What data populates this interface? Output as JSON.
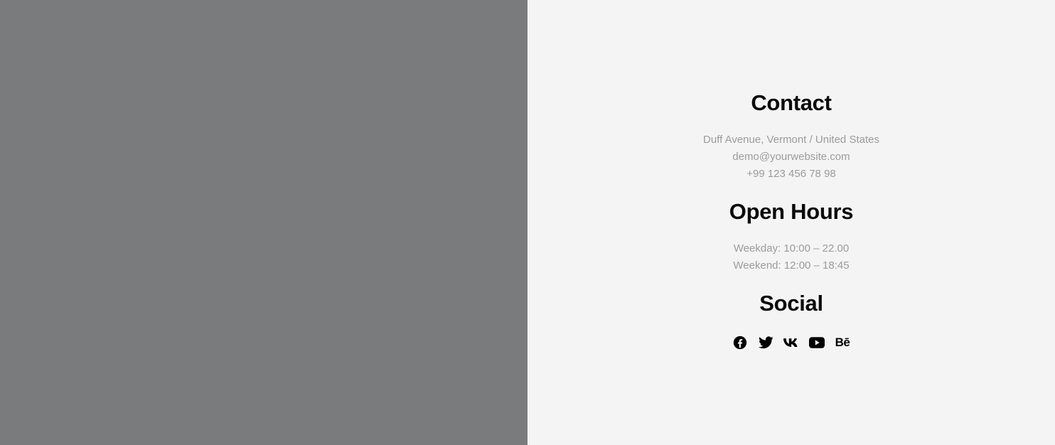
{
  "colors": {
    "image_panel_bg": "#7a7b7d",
    "info_panel_bg": "#f4f4f4",
    "heading": "#0a0a0a",
    "body_text": "#9b9b9b"
  },
  "contact": {
    "title": "Contact",
    "address": "Duff Avenue, Vermont / United States",
    "email": "demo@yourwebsite.com",
    "phone": "+99 123 456 78 98"
  },
  "hours": {
    "title": "Open Hours",
    "weekday": "Weekday: 10:00 – 22.00",
    "weekend": "Weekend: 12:00 – 18:45"
  },
  "social": {
    "title": "Social",
    "links": [
      {
        "icon": "facebook-icon"
      },
      {
        "icon": "twitter-icon"
      },
      {
        "icon": "vk-icon"
      },
      {
        "icon": "youtube-icon"
      },
      {
        "icon": "behance-icon",
        "glyph": "Bē"
      }
    ]
  }
}
